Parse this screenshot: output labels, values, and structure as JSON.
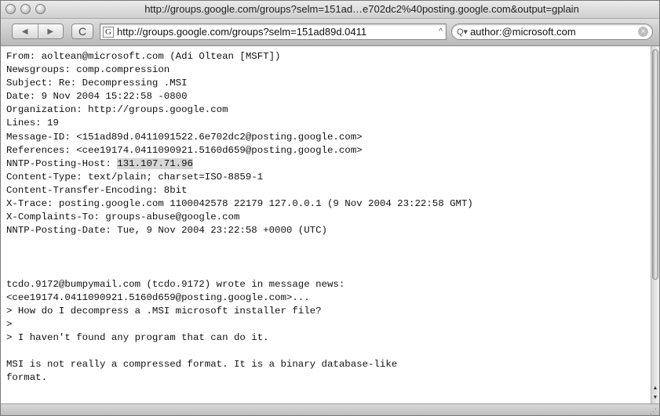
{
  "window": {
    "title": "http://groups.google.com/groups?selm=151ad…e702dc2%40posting.google.com&output=gplain"
  },
  "toolbar": {
    "back_icon": "◀",
    "forward_icon": "▶",
    "reload_icon": "C",
    "favicon": "G",
    "url": "http://groups.google.com/groups?selm=151ad89d.0411",
    "url_caret": "^",
    "search_icon": "Q▾",
    "search_value": "author:@microsoft.com",
    "search_clear": "×"
  },
  "message": {
    "headers": [
      "From: aoltean@microsoft.com (Adi Oltean [MSFT])",
      "Newsgroups: comp.compression",
      "Subject: Re: Decompressing .MSI",
      "Date: 9 Nov 2004 15:22:58 -0800",
      "Organization: http://groups.google.com",
      "Lines: 19",
      "Message-ID: <151ad89d.0411091522.6e702dc2@posting.google.com>",
      "References: <cee19174.0411090921.5160d659@posting.google.com>"
    ],
    "nntp_host_label": "NNTP-Posting-Host: ",
    "nntp_host_value": "131.107.71.96",
    "headers_after": [
      "Content-Type: text/plain; charset=ISO-8859-1",
      "Content-Transfer-Encoding: 8bit",
      "X-Trace: posting.google.com 1100042578 22179 127.0.0.1 (9 Nov 2004 23:22:58 GMT)",
      "X-Complaints-To: groups-abuse@google.com",
      "NNTP-Posting-Date: Tue, 9 Nov 2004 23:22:58 +0000 (UTC)"
    ],
    "body": [
      "",
      "",
      "",
      "tcdo.9172@bumpymail.com (tcdo.9172) wrote in message news:",
      "<cee19174.0411090921.5160d659@posting.google.com>...",
      "> How do I decompress a .MSI microsoft installer file?",
      ">",
      "> I haven't found any program that can do it.",
      "",
      "MSI is not really a compressed format. It is a binary database-like",
      "format."
    ]
  },
  "scrollbar": {
    "up_icon": "▲",
    "down_icon": "▼"
  },
  "statusbar": {
    "grip_icon": "⋰"
  }
}
